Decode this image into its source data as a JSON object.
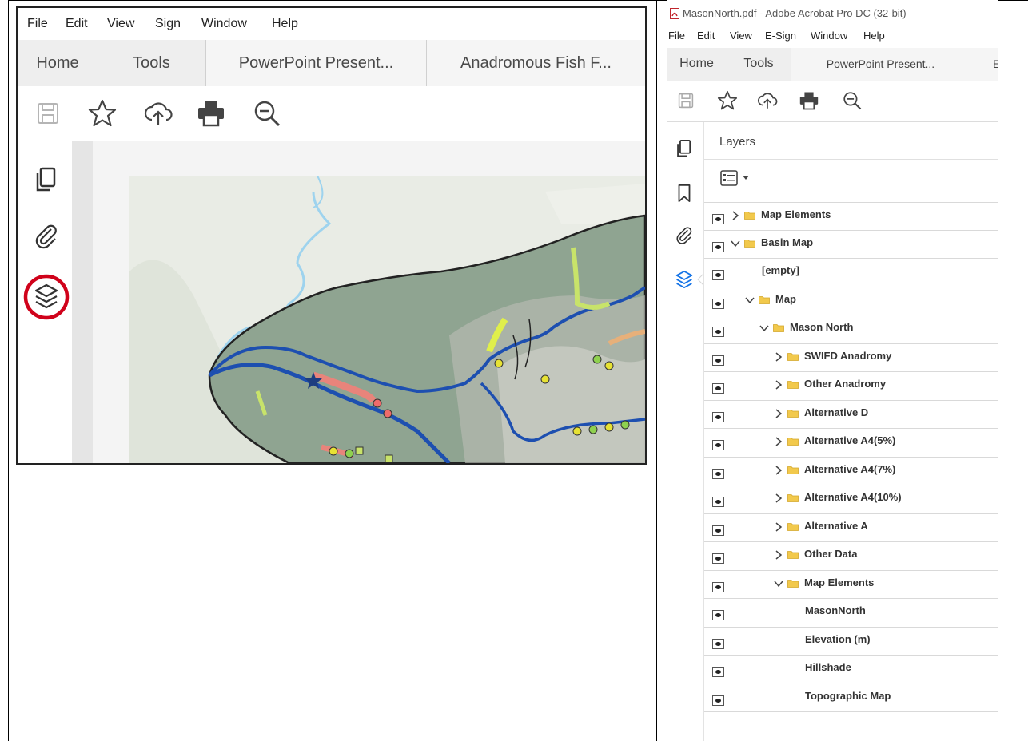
{
  "left": {
    "menu": [
      "File",
      "Edit",
      "View",
      "Sign",
      "Window",
      "Help"
    ],
    "tabs": [
      "Home",
      "Tools",
      "PowerPoint Present...",
      "Anadromous Fish F..."
    ],
    "toolbar_icons": [
      "save-icon",
      "star-icon",
      "upload-icon",
      "print-icon",
      "zoom-out-icon"
    ],
    "rail_icons": [
      "pages-icon",
      "attachment-icon",
      "layers-icon"
    ],
    "highlight_color": "#d0021b"
  },
  "right": {
    "window_title": "MasonNorth.pdf - Adobe Acrobat Pro DC (32-bit)",
    "menu": [
      "File",
      "Edit",
      "View",
      "E-Sign",
      "Window",
      "Help"
    ],
    "tabs": [
      "Home",
      "Tools",
      "PowerPoint Present...",
      "E"
    ],
    "toolbar_icons": [
      "save-icon",
      "star-icon",
      "upload-icon",
      "print-icon",
      "zoom-out-icon"
    ],
    "rail_icons": [
      "pages-icon",
      "bookmark-icon",
      "attachment-icon",
      "layers-icon"
    ],
    "accent_color": "#1473e6",
    "panel_title": "Layers",
    "layers": [
      {
        "name": "Map Elements",
        "level": 0,
        "chevron": "right",
        "folder": true
      },
      {
        "name": "Basin Map",
        "level": 0,
        "chevron": "down",
        "folder": true
      },
      {
        "name": "[empty]",
        "level": 1,
        "chevron": "",
        "folder": false
      },
      {
        "name": "Map",
        "level": 1,
        "chevron": "down",
        "folder": true
      },
      {
        "name": "Mason North",
        "level": 2,
        "chevron": "down",
        "folder": true
      },
      {
        "name": "SWIFD Anadromy",
        "level": 3,
        "chevron": "right",
        "folder": true
      },
      {
        "name": "Other Anadromy",
        "level": 3,
        "chevron": "right",
        "folder": true
      },
      {
        "name": "Alternative D",
        "level": 3,
        "chevron": "right",
        "folder": true
      },
      {
        "name": "Alternative A4(5%)",
        "level": 3,
        "chevron": "right",
        "folder": true
      },
      {
        "name": "Alternative A4(7%)",
        "level": 3,
        "chevron": "right",
        "folder": true
      },
      {
        "name": "Alternative A4(10%)",
        "level": 3,
        "chevron": "right",
        "folder": true
      },
      {
        "name": "Alternative A",
        "level": 3,
        "chevron": "right",
        "folder": true
      },
      {
        "name": "Other Data",
        "level": 3,
        "chevron": "right",
        "folder": true
      },
      {
        "name": "Map Elements",
        "level": 3,
        "chevron": "down",
        "folder": true
      },
      {
        "name": "MasonNorth",
        "level": 4,
        "chevron": "",
        "folder": false
      },
      {
        "name": "Elevation (m)",
        "level": 4,
        "chevron": "",
        "folder": false
      },
      {
        "name": "Hillshade",
        "level": 4,
        "chevron": "",
        "folder": false
      },
      {
        "name": "Topographic Map",
        "level": 4,
        "chevron": "",
        "folder": false
      }
    ]
  }
}
